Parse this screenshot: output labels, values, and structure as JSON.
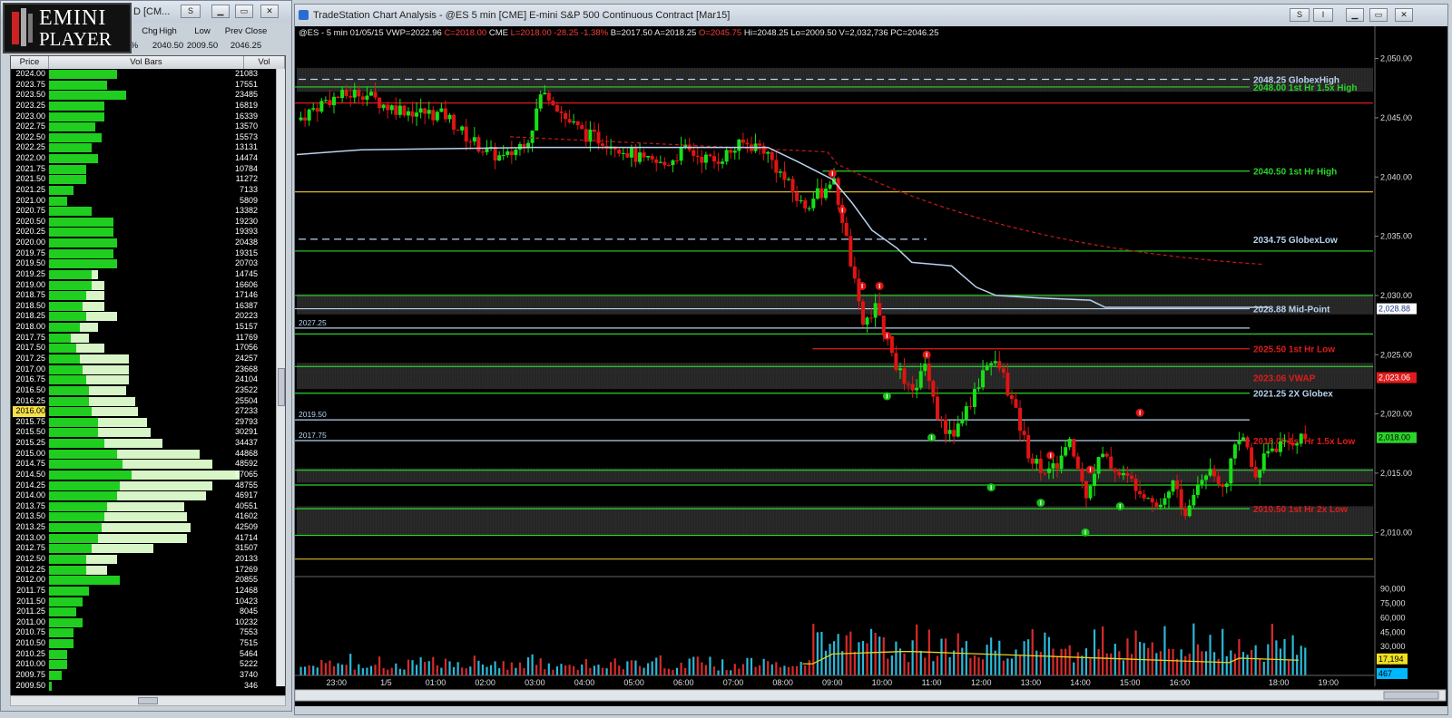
{
  "left_window": {
    "logo_line1": "EMINI",
    "logo_line2": "PLAYER",
    "title": "D [CM...",
    "hdr_chg": "Chg",
    "hdr_high": "High",
    "hdr_low": "Low",
    "hdr_prevclose": "Prev Close",
    "val_chg": "%",
    "val_high": "2040.50",
    "val_low": "2009.50",
    "val_prevclose": "2046.25",
    "col_price": "Price",
    "col_volbars": "Vol Bars",
    "col_vol": "Vol",
    "highlighted_price": "2016.00",
    "rows": [
      {
        "price": "2024.00",
        "vol": "21083",
        "w": 0.22,
        "g": 0.22
      },
      {
        "price": "2023.75",
        "vol": "17551",
        "w": 0.19,
        "g": 0.19
      },
      {
        "price": "2023.50",
        "vol": "23485",
        "w": 0.25,
        "g": 0.25
      },
      {
        "price": "2023.25",
        "vol": "16819",
        "w": 0.18,
        "g": 0.18
      },
      {
        "price": "2023.00",
        "vol": "16339",
        "w": 0.18,
        "g": 0.18
      },
      {
        "price": "2022.75",
        "vol": "13570",
        "w": 0.15,
        "g": 0.15
      },
      {
        "price": "2022.50",
        "vol": "15573",
        "w": 0.17,
        "g": 0.17
      },
      {
        "price": "2022.25",
        "vol": "13131",
        "w": 0.14,
        "g": 0.14
      },
      {
        "price": "2022.00",
        "vol": "14474",
        "w": 0.16,
        "g": 0.16
      },
      {
        "price": "2021.75",
        "vol": "10784",
        "w": 0.12,
        "g": 0.12
      },
      {
        "price": "2021.50",
        "vol": "11272",
        "w": 0.12,
        "g": 0.12
      },
      {
        "price": "2021.25",
        "vol": "7133",
        "w": 0.08,
        "g": 0.08
      },
      {
        "price": "2021.00",
        "vol": "5809",
        "w": 0.06,
        "g": 0.06
      },
      {
        "price": "2020.75",
        "vol": "13382",
        "w": 0.14,
        "g": 0.14
      },
      {
        "price": "2020.50",
        "vol": "19230",
        "w": 0.21,
        "g": 0.21
      },
      {
        "price": "2020.25",
        "vol": "19393",
        "w": 0.21,
        "g": 0.21
      },
      {
        "price": "2020.00",
        "vol": "20438",
        "w": 0.22,
        "g": 0.22
      },
      {
        "price": "2019.75",
        "vol": "19315",
        "w": 0.21,
        "g": 0.21
      },
      {
        "price": "2019.50",
        "vol": "20703",
        "w": 0.22,
        "g": 0.22
      },
      {
        "price": "2019.25",
        "vol": "14745",
        "w": 0.16,
        "g": 0.14
      },
      {
        "price": "2019.00",
        "vol": "16606",
        "w": 0.18,
        "g": 0.14
      },
      {
        "price": "2018.75",
        "vol": "17146",
        "w": 0.18,
        "g": 0.12
      },
      {
        "price": "2018.50",
        "vol": "16387",
        "w": 0.18,
        "g": 0.11
      },
      {
        "price": "2018.25",
        "vol": "20223",
        "w": 0.22,
        "g": 0.12
      },
      {
        "price": "2018.00",
        "vol": "15157",
        "w": 0.16,
        "g": 0.1
      },
      {
        "price": "2017.75",
        "vol": "11769",
        "w": 0.13,
        "g": 0.07
      },
      {
        "price": "2017.50",
        "vol": "17056",
        "w": 0.18,
        "g": 0.09
      },
      {
        "price": "2017.25",
        "vol": "24257",
        "w": 0.26,
        "g": 0.1
      },
      {
        "price": "2017.00",
        "vol": "23668",
        "w": 0.26,
        "g": 0.11
      },
      {
        "price": "2016.75",
        "vol": "24104",
        "w": 0.26,
        "g": 0.12
      },
      {
        "price": "2016.50",
        "vol": "23522",
        "w": 0.25,
        "g": 0.13
      },
      {
        "price": "2016.25",
        "vol": "25504",
        "w": 0.28,
        "g": 0.13
      },
      {
        "price": "2016.00",
        "vol": "27233",
        "w": 0.29,
        "g": 0.14
      },
      {
        "price": "2015.75",
        "vol": "29793",
        "w": 0.32,
        "g": 0.16
      },
      {
        "price": "2015.50",
        "vol": "30291",
        "w": 0.33,
        "g": 0.16
      },
      {
        "price": "2015.25",
        "vol": "34437",
        "w": 0.37,
        "g": 0.18
      },
      {
        "price": "2015.00",
        "vol": "44868",
        "w": 0.49,
        "g": 0.22
      },
      {
        "price": "2014.75",
        "vol": "48592",
        "w": 0.53,
        "g": 0.24
      },
      {
        "price": "2014.50",
        "vol": "57065",
        "w": 0.62,
        "g": 0.27
      },
      {
        "price": "2014.25",
        "vol": "48755",
        "w": 0.53,
        "g": 0.23
      },
      {
        "price": "2014.00",
        "vol": "46917",
        "w": 0.51,
        "g": 0.22
      },
      {
        "price": "2013.75",
        "vol": "40551",
        "w": 0.44,
        "g": 0.19
      },
      {
        "price": "2013.50",
        "vol": "41602",
        "w": 0.45,
        "g": 0.18
      },
      {
        "price": "2013.25",
        "vol": "42509",
        "w": 0.46,
        "g": 0.17
      },
      {
        "price": "2013.00",
        "vol": "41714",
        "w": 0.45,
        "g": 0.16
      },
      {
        "price": "2012.75",
        "vol": "31507",
        "w": 0.34,
        "g": 0.14
      },
      {
        "price": "2012.50",
        "vol": "20133",
        "w": 0.22,
        "g": 0.12
      },
      {
        "price": "2012.25",
        "vol": "17269",
        "w": 0.19,
        "g": 0.12
      },
      {
        "price": "2012.00",
        "vol": "20855",
        "w": 0.23,
        "g": 0.23
      },
      {
        "price": "2011.75",
        "vol": "12468",
        "w": 0.13,
        "g": 0.13
      },
      {
        "price": "2011.50",
        "vol": "10423",
        "w": 0.11,
        "g": 0.11
      },
      {
        "price": "2011.25",
        "vol": "8045",
        "w": 0.09,
        "g": 0.09
      },
      {
        "price": "2011.00",
        "vol": "10232",
        "w": 0.11,
        "g": 0.11
      },
      {
        "price": "2010.75",
        "vol": "7553",
        "w": 0.08,
        "g": 0.08
      },
      {
        "price": "2010.50",
        "vol": "7515",
        "w": 0.08,
        "g": 0.08
      },
      {
        "price": "2010.25",
        "vol": "5464",
        "w": 0.06,
        "g": 0.06
      },
      {
        "price": "2010.00",
        "vol": "5222",
        "w": 0.06,
        "g": 0.06
      },
      {
        "price": "2009.75",
        "vol": "3740",
        "w": 0.04,
        "g": 0.04
      },
      {
        "price": "2009.50",
        "vol": "346",
        "w": 0.01,
        "g": 0.01
      }
    ]
  },
  "right_window": {
    "title": "TradeStation Chart Analysis - @ES 5 min [CME] E-mini S&P 500 Continuous Contract [Mar15]",
    "btn_s": "S",
    "btn_i": "I"
  },
  "chart_data": {
    "type": "candlestick",
    "symbol": "@ES - 5 min",
    "date": "01/05/15",
    "info_white": [
      "@ES - 5 min",
      "01/05/15",
      "VWP=2022.96"
    ],
    "info_red": [
      "C=2018.00"
    ],
    "info_white2": [
      "CME"
    ],
    "info_red2": [
      "L=2018.00",
      "-28.25",
      "-1.38%"
    ],
    "info_white3": [
      "B=2017.50",
      "A=2018.25"
    ],
    "info_red3": [
      "O=2045.75"
    ],
    "info_white4": [
      "Hi=2048.25",
      "Lo=2009.50",
      "V=2,032,736",
      "PC=2046.25"
    ],
    "ylim": [
      2006.5,
      2051.5
    ],
    "y_ticks": [
      "2,050.00",
      "2,045.00",
      "2,040.00",
      "2,035.00",
      "2,030.00",
      "2,025.00",
      "2,020.00",
      "2,015.00",
      "2,010.00"
    ],
    "y_tick_values": [
      2050,
      2045,
      2040,
      2035,
      2030,
      2025,
      2020,
      2015,
      2010
    ],
    "x_labels": [
      "23:00",
      "1/5",
      "01:00",
      "02:00",
      "03:00",
      "04:00",
      "05:00",
      "06:00",
      "07:00",
      "08:00",
      "09:00",
      "10:00",
      "11:00",
      "12:00",
      "13:00",
      "14:00",
      "15:00",
      "16:00",
      "18:00",
      "19:00"
    ],
    "x_label_hours": [
      23,
      24,
      25,
      26,
      27,
      28,
      29,
      30,
      31,
      32,
      33,
      34,
      35,
      36,
      37,
      38,
      39,
      40,
      42,
      43
    ],
    "price_right_labels": [
      {
        "text": "2,028.88",
        "value": 2028.88,
        "bg": "#ffffff",
        "fg": "#1a3a8a"
      },
      {
        "text": "2,023.06",
        "value": 2023.06,
        "bg": "#e01b1b",
        "fg": "#ffffff"
      },
      {
        "text": "2,018.00",
        "value": 2018.0,
        "bg": "#2ad42a",
        "fg": "#000000"
      }
    ],
    "levels": [
      {
        "label": "2048.25 GlobexHigh",
        "value": 2048.25,
        "color": "#b7d3ee",
        "start_h": 22.0,
        "dashed": true,
        "label_color": "#b7d3ee"
      },
      {
        "label": "2048.00 1st Hr 1.5x High",
        "value": 2047.6,
        "color": "#2ad42a",
        "start_h": 22.0,
        "dashed": false,
        "label_color": "#2ad42a"
      },
      {
        "label": "",
        "value": 2046.25,
        "color": "#e01b1b",
        "start_h": 22.0,
        "dashed": false,
        "label_color": ""
      },
      {
        "label": "2040.50 1st Hr  High",
        "value": 2040.5,
        "color": "#2ad42a",
        "start_h": 32.8,
        "dashed": false,
        "label_color": "#2ad42a"
      },
      {
        "label": "",
        "value": 2038.75,
        "color": "#d8b830",
        "start_h": 22.0,
        "dashed": false,
        "label_color": ""
      },
      {
        "label": "2034.75 GlobexLow",
        "value": 2034.75,
        "color": "#b7d3ee",
        "start_h": 22.0,
        "dashed": true,
        "label_color": "#b7d3ee",
        "end_h": 34.9
      },
      {
        "label": "",
        "value": 2033.75,
        "color": "#2ad42a",
        "start_h": 22.0,
        "dashed": false,
        "label_color": ""
      },
      {
        "label": "",
        "value": 2030.0,
        "color": "#2ad42a",
        "start_h": 22.0,
        "dashed": false,
        "label_color": ""
      },
      {
        "label": "2028.88 Mid-Point",
        "value": 2028.88,
        "color": "#b7d3ee",
        "start_h": 22.0,
        "dashed": false,
        "label_color": "#b7d3ee"
      },
      {
        "label": "2027.25",
        "value": 2027.25,
        "color": "#b7d3ee",
        "start_h": 22.0,
        "dashed": false,
        "label_color": "#b7d3ee",
        "left_label": true
      },
      {
        "label": "",
        "value": 2026.75,
        "color": "#2ad42a",
        "start_h": 22.0,
        "dashed": false,
        "label_color": ""
      },
      {
        "label": "2025.50 1st Hr  Low",
        "value": 2025.5,
        "color": "#e01b1b",
        "start_h": 32.6,
        "dashed": false,
        "label_color": "#e01b1b"
      },
      {
        "label": "2023.06 VWAP",
        "value": 2023.06,
        "color": "#e01b1b",
        "start_h": 99,
        "dashed": false,
        "label_color": "#e01b1b"
      },
      {
        "label": "",
        "value": 2024.0,
        "color": "#2ad42a",
        "start_h": 22.0,
        "dashed": false,
        "label_color": ""
      },
      {
        "label": "2021.25 2X Globex",
        "value": 2021.75,
        "color": "#2ad42a",
        "start_h": 22.0,
        "dashed": false,
        "label_color": "#b7d3ee"
      },
      {
        "label": "2019.50",
        "value": 2019.5,
        "color": "#b7d3ee",
        "start_h": 22.0,
        "dashed": false,
        "label_color": "#b7d3ee",
        "left_label": true
      },
      {
        "label": "2018.00 1st Hr  1.5x Low",
        "value": 2017.75,
        "color": "#b7d3ee",
        "start_h": 22.0,
        "dashed": false,
        "label_color": "#e01b1b",
        "left_text": "2017.75"
      },
      {
        "label": "",
        "value": 2015.25,
        "color": "#2ad42a",
        "start_h": 22.0,
        "dashed": false,
        "label_color": ""
      },
      {
        "label": "",
        "value": 2014.0,
        "color": "#2ad42a",
        "start_h": 22.0,
        "dashed": false,
        "label_color": ""
      },
      {
        "label": "2010.50 1st Hr  2x Low",
        "value": 2012.0,
        "color": "#2ad42a",
        "start_h": 22.0,
        "dashed": false,
        "label_color": "#e01b1b"
      },
      {
        "label": "",
        "value": 2009.75,
        "color": "#2ad42a",
        "start_h": 22.0,
        "dashed": false,
        "label_color": ""
      },
      {
        "label": "",
        "value": 2007.75,
        "color": "#d8b830",
        "start_h": 22.0,
        "dashed": false,
        "label_color": ""
      }
    ],
    "shaded_zones": [
      [
        2047.2,
        2049.2
      ],
      [
        2028.4,
        2030.1
      ],
      [
        2022.1,
        2024.3
      ],
      [
        2014.2,
        2015.4
      ],
      [
        2009.8,
        2012.2
      ]
    ],
    "volume_ticks": [
      "90,000",
      "75,000",
      "60,000",
      "45,000",
      "30,000",
      "15,000"
    ],
    "volume_tick_values": [
      90000,
      75000,
      60000,
      45000,
      30000,
      15000
    ],
    "volume_max": 100000,
    "volume_labels": [
      {
        "text": "17,194",
        "value": 17194,
        "bg": "#f0e020",
        "fg": "#000"
      },
      {
        "text": "467",
        "value": 467,
        "bg": "#00b8ff",
        "fg": "#000"
      }
    ]
  }
}
